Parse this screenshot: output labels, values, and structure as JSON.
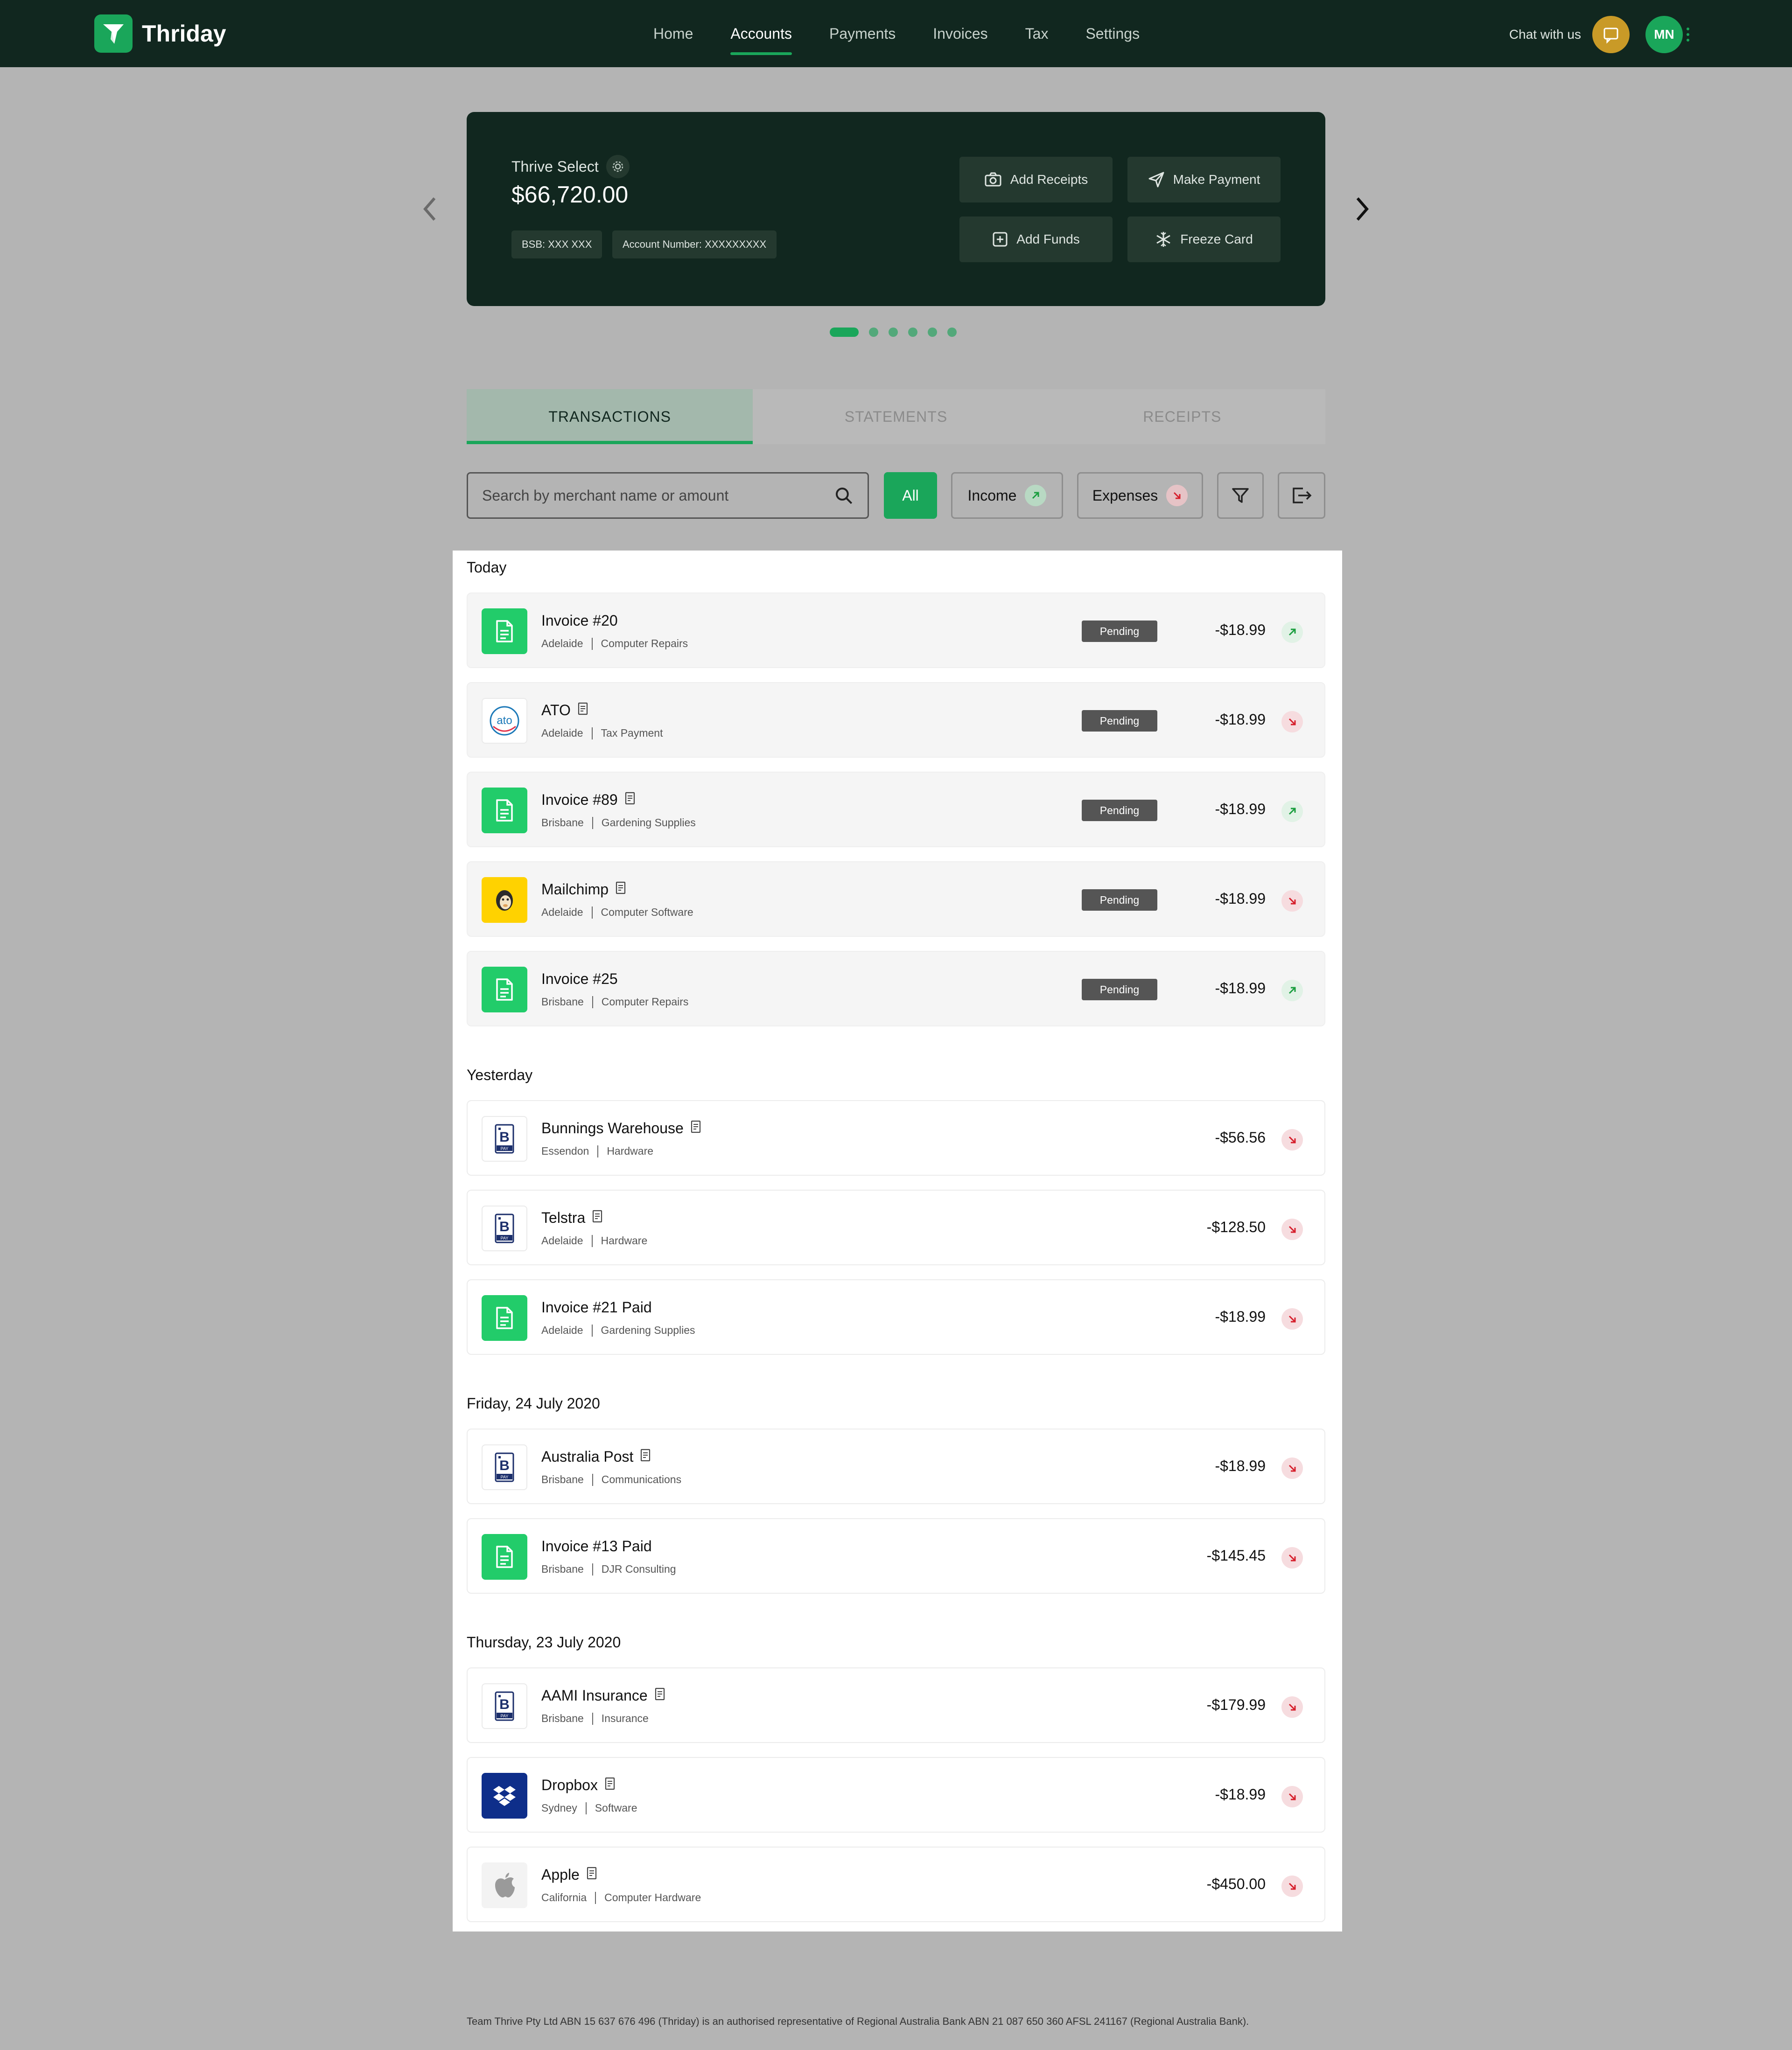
{
  "app": {
    "name": "Thriday",
    "nav": [
      {
        "label": "Home"
      },
      {
        "label": "Accounts"
      },
      {
        "label": "Payments"
      },
      {
        "label": "Invoices"
      },
      {
        "label": "Tax"
      },
      {
        "label": "Settings"
      }
    ],
    "active_nav": "Accounts",
    "chat_label": "Chat with us",
    "avatar_initials": "MN"
  },
  "account": {
    "name": "Thrive Select",
    "balance": "$66,720.00",
    "bsb": "BSB: XXX XXX",
    "account_number": "Account Number: XXXXXXXXX",
    "actions": {
      "add_receipts": "Add Receipts",
      "make_payment": "Make Payment",
      "add_funds": "Add Funds",
      "freeze_card": "Freeze Card"
    },
    "carousel": {
      "count": 6,
      "active_index": 0
    }
  },
  "tabs": [
    {
      "label": "TRANSACTIONS"
    },
    {
      "label": "STATEMENTS"
    },
    {
      "label": "RECEIPTS"
    }
  ],
  "filters": {
    "search_placeholder": "Search by merchant name or amount",
    "all": "All",
    "income": "Income",
    "expenses": "Expenses"
  },
  "groups": [
    {
      "label": "Today"
    },
    {
      "label": "Yesterday"
    },
    {
      "label": "Friday, 24 July 2020"
    },
    {
      "label": "Thursday, 23 July 2020"
    }
  ],
  "transactions": [
    {
      "merchant": "Invoice #20",
      "location": "Adelaide",
      "category": "Computer Repairs",
      "status": "Pending",
      "amount": "-$18.99",
      "direction": "up",
      "icon": "invoice-icon",
      "receipt": false
    },
    {
      "merchant": "ATO",
      "location": "Adelaide",
      "category": "Tax Payment",
      "status": "Pending",
      "amount": "-$18.99",
      "direction": "down",
      "icon": "ato-logo",
      "receipt": true
    },
    {
      "merchant": "Invoice #89",
      "location": "Brisbane",
      "category": "Gardening Supplies",
      "status": "Pending",
      "amount": "-$18.99",
      "direction": "up",
      "icon": "invoice-icon",
      "receipt": true
    },
    {
      "merchant": "Mailchimp",
      "location": "Adelaide",
      "category": "Computer Software",
      "status": "Pending",
      "amount": "-$18.99",
      "direction": "down",
      "icon": "mailchimp-logo",
      "receipt": true
    },
    {
      "merchant": "Invoice #25",
      "location": "Brisbane",
      "category": "Computer Repairs",
      "status": "Pending",
      "amount": "-$18.99",
      "direction": "up",
      "icon": "invoice-icon",
      "receipt": false
    },
    {
      "merchant": "Bunnings Warehouse",
      "location": "Essendon",
      "category": "Hardware",
      "amount": "-$56.56",
      "direction": "down",
      "icon": "bpay-logo",
      "receipt": true
    },
    {
      "merchant": "Telstra",
      "location": "Adelaide",
      "category": "Hardware",
      "amount": "-$128.50",
      "direction": "down",
      "icon": "bpay-logo",
      "receipt": true
    },
    {
      "merchant": "Invoice #21 Paid",
      "location": "Adelaide",
      "category": "Gardening Supplies",
      "amount": "-$18.99",
      "direction": "down",
      "icon": "invoice-icon",
      "receipt": false
    },
    {
      "merchant": "Australia Post",
      "location": "Brisbane",
      "category": "Communications",
      "amount": "-$18.99",
      "direction": "down",
      "icon": "bpay-logo",
      "receipt": true
    },
    {
      "merchant": "Invoice #13 Paid",
      "location": "Brisbane",
      "category": "DJR Consulting",
      "amount": "-$145.45",
      "direction": "down",
      "icon": "invoice-icon",
      "receipt": false
    },
    {
      "merchant": "AAMI Insurance",
      "location": "Brisbane",
      "category": "Insurance",
      "amount": "-$179.99",
      "direction": "down",
      "icon": "bpay-logo",
      "receipt": true
    },
    {
      "merchant": "Dropbox",
      "location": "Sydney",
      "category": "Software",
      "amount": "-$18.99",
      "direction": "down",
      "icon": "dropbox-logo",
      "receipt": true
    },
    {
      "merchant": "Apple",
      "location": "California",
      "category": "Computer Hardware",
      "amount": "-$450.00",
      "direction": "down",
      "icon": "apple-logo",
      "receipt": true
    }
  ],
  "colors": {
    "brand_dark": "#11271f",
    "brand_green": "#1aa65a",
    "invoice_green": "#22cc6a",
    "income_arrow": "#1a9e3f",
    "expense_arrow": "#d61f2c",
    "chat_gold": "#c99a27"
  },
  "footer": "Team Thrive Pty Ltd ABN 15 637 676 496 (Thriday) is an authorised representative of Regional Australia Bank ABN 21 087 650 360 AFSL 241167 (Regional Australia Bank)."
}
